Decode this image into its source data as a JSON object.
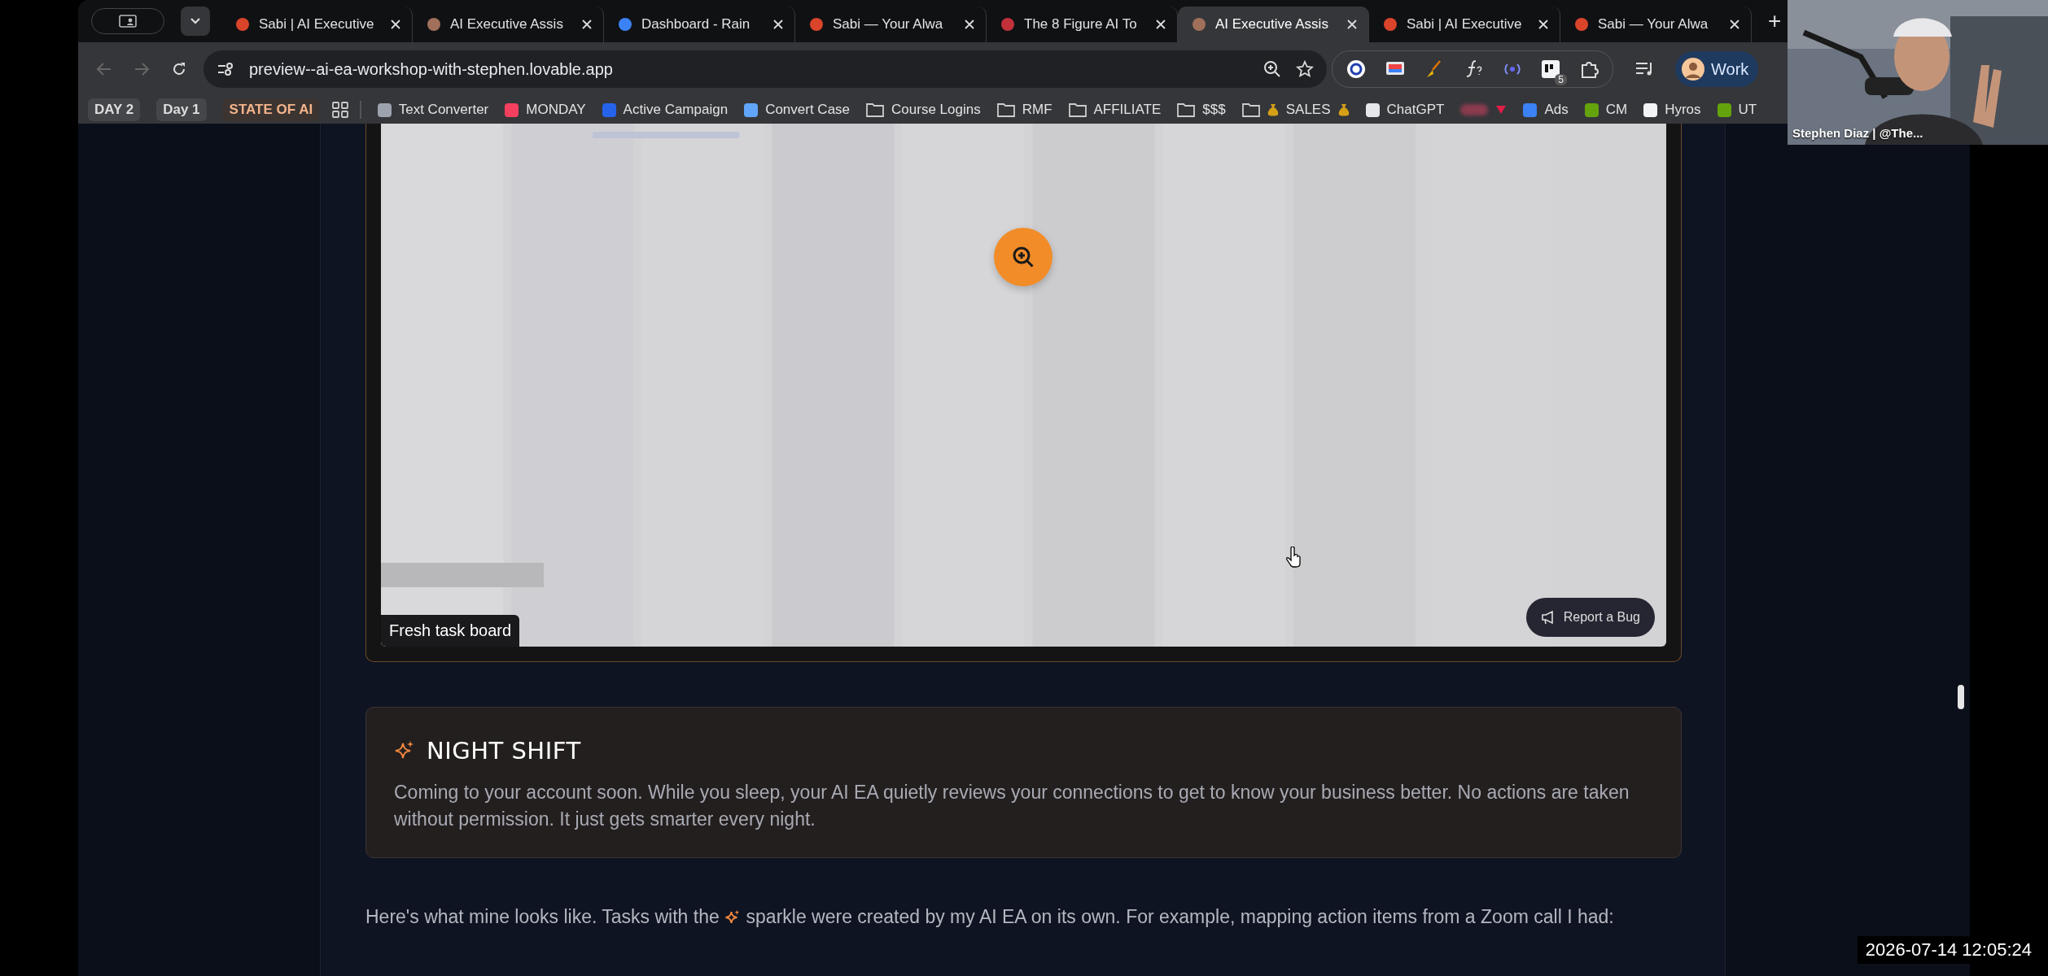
{
  "browser": {
    "tabs": [
      {
        "title": "Sabi | AI Executive",
        "selected": false,
        "color": "#d9442b"
      },
      {
        "title": "AI Executive Assis",
        "selected": false,
        "color": "#a0705a"
      },
      {
        "title": "Dashboard - Rain",
        "selected": false,
        "color": "#3b82f6"
      },
      {
        "title": "Sabi — Your Alwa",
        "selected": false,
        "color": "#d9442b"
      },
      {
        "title": "The 8 Figure AI To",
        "selected": false,
        "color": "#c2303a"
      },
      {
        "title": "AI Executive Assis",
        "selected": true,
        "color": "#a0705a"
      },
      {
        "title": "Sabi | AI Executive",
        "selected": false,
        "color": "#d9442b"
      },
      {
        "title": "Sabi — Your Alwa",
        "selected": false,
        "color": "#d9442b"
      }
    ],
    "new_tab": "+",
    "address": "preview--ai-ea-workshop-with-stephen.lovable.app",
    "extension_badge": "5",
    "profile": "Work",
    "bookmarks": [
      {
        "kind": "chip",
        "label": "DAY 2"
      },
      {
        "kind": "chip",
        "label": "Day 1"
      },
      {
        "kind": "chip-accent",
        "label": "STATE OF AI"
      },
      {
        "kind": "apps"
      },
      {
        "kind": "site",
        "label": "Text Converter",
        "color": "#9ca3af"
      },
      {
        "kind": "site",
        "label": "MONDAY",
        "color": "#f43f5e"
      },
      {
        "kind": "site",
        "label": "Active Campaign",
        "color": "#2563eb"
      },
      {
        "kind": "site",
        "label": "Convert Case",
        "color": "#60a5fa"
      },
      {
        "kind": "folder",
        "label": "Course Logins"
      },
      {
        "kind": "folder",
        "label": "RMF"
      },
      {
        "kind": "folder",
        "label": "AFFILIATE"
      },
      {
        "kind": "folder",
        "label": "$$$"
      },
      {
        "kind": "money-folder",
        "label": "SALES"
      },
      {
        "kind": "site",
        "label": "ChatGPT",
        "color": "#e5e7eb"
      },
      {
        "kind": "redacted"
      },
      {
        "kind": "site",
        "label": "Ads",
        "color": "#3b82f6"
      },
      {
        "kind": "site",
        "label": "CM",
        "color": "#65a30d"
      },
      {
        "kind": "site",
        "label": "Hyros",
        "color": "#f3f4f6"
      },
      {
        "kind": "site",
        "label": "UT",
        "color": "#65a30d"
      }
    ]
  },
  "page": {
    "figure": {
      "caption": "Fresh task board",
      "report_button": "Report a Bug"
    },
    "callout": {
      "title": "NIGHT SHIFT",
      "body": "Coming to your account soon. While you sleep, your AI EA quietly reviews your connections to get to know your business better. No actions are taken without permission. It just gets smarter every night."
    },
    "paragraph": {
      "before": "Here's what mine looks like. Tasks with the",
      "after": "sparkle were created by my AI EA on its own. For example, mapping action items from a Zoom call I had:"
    }
  },
  "webcam": {
    "name_label": "Stephen Diaz | @The..."
  },
  "timestamp": "2026-07-14 12:05:24"
}
